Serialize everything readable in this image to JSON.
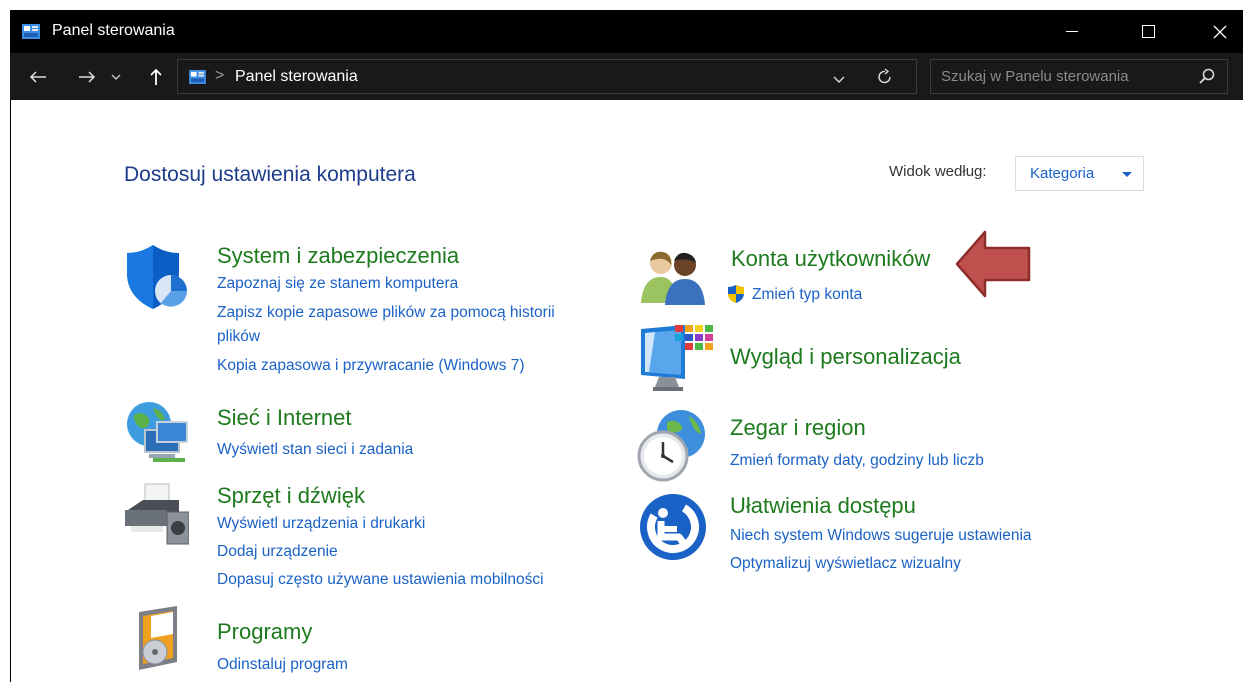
{
  "window": {
    "title": "Panel sterowania"
  },
  "address": {
    "crumb": "Panel sterowania",
    "separator": ">"
  },
  "search": {
    "placeholder": "Szukaj w Panelu sterowania"
  },
  "page": {
    "title": "Dostosuj ustawienia komputera"
  },
  "view": {
    "label": "Widok według:",
    "value": "Kategoria"
  },
  "categories": {
    "system": {
      "title": "System i zabezpieczenia",
      "links": [
        "Zapoznaj się ze stanem komputera",
        "Zapisz kopie zapasowe plików za pomocą historii",
        "plików",
        "Kopia zapasowa i przywracanie (Windows 7)"
      ]
    },
    "network": {
      "title": "Sieć i Internet",
      "links": [
        "Wyświetl stan sieci i zadania"
      ]
    },
    "hardware": {
      "title": "Sprzęt i dźwięk",
      "links": [
        "Wyświetl urządzenia i drukarki",
        "Dodaj urządzenie",
        "Dopasuj często używane ustawienia mobilności"
      ]
    },
    "programs": {
      "title": "Programy",
      "links": [
        "Odinstaluj program"
      ]
    },
    "accounts": {
      "title": "Konta użytkowników",
      "links": [
        "Zmień typ konta"
      ]
    },
    "appearance": {
      "title": "Wygląd i personalizacja"
    },
    "clock": {
      "title": "Zegar i region",
      "links": [
        "Zmień formaty daty, godziny lub liczb"
      ]
    },
    "ease": {
      "title": "Ułatwienia dostępu",
      "links": [
        "Niech system Windows sugeruje ustawienia",
        "Optymalizuj wyświetlacz wizualny"
      ]
    }
  },
  "colors": {
    "category_title": "#1d7a1d",
    "link": "#1a62c6",
    "page_title": "#1e3c8a",
    "annotation_arrow": "#c0504d"
  }
}
